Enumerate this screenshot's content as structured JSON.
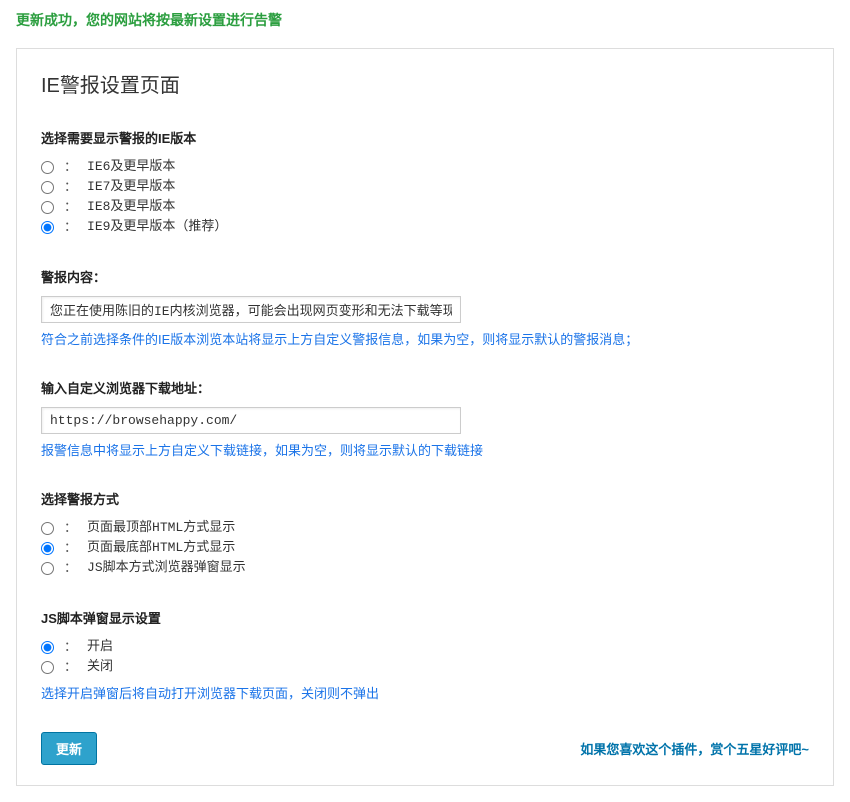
{
  "success_message": "更新成功，您的网站将按最新设置进行告警",
  "page_title": "IE警报设置页面",
  "ie_version": {
    "label": "选择需要显示警报的IE版本",
    "options": [
      "IE6及更早版本",
      "IE7及更早版本",
      "IE8及更早版本",
      "IE9及更早版本（推荐）"
    ],
    "selected": 3
  },
  "alert_content": {
    "label": "警报内容：",
    "value": "您正在使用陈旧的IE内核浏览器，可能会出现网页变形和无法下载等现象，请使",
    "help": "符合之前选择条件的IE版本浏览本站将显示上方自定义警报信息，如果为空，则将显示默认的警报消息；"
  },
  "download_url": {
    "label": "输入自定义浏览器下载地址：",
    "value": "https://browsehappy.com/",
    "help": "报警信息中将显示上方自定义下载链接，如果为空，则将显示默认的下载链接"
  },
  "alert_method": {
    "label": "选择警报方式",
    "options": [
      "页面最顶部HTML方式显示",
      "页面最底部HTML方式显示",
      "JS脚本方式浏览器弹窗显示"
    ],
    "selected": 1
  },
  "js_popup": {
    "label": "JS脚本弹窗显示设置",
    "options": [
      "开启",
      "关闭"
    ],
    "selected": 0,
    "help": "选择开启弹窗后将自动打开浏览器下载页面，关闭则不弹出"
  },
  "update_button": "更新",
  "footer_link": "如果您喜欢这个插件，赏个五星好评吧~",
  "colon": "："
}
